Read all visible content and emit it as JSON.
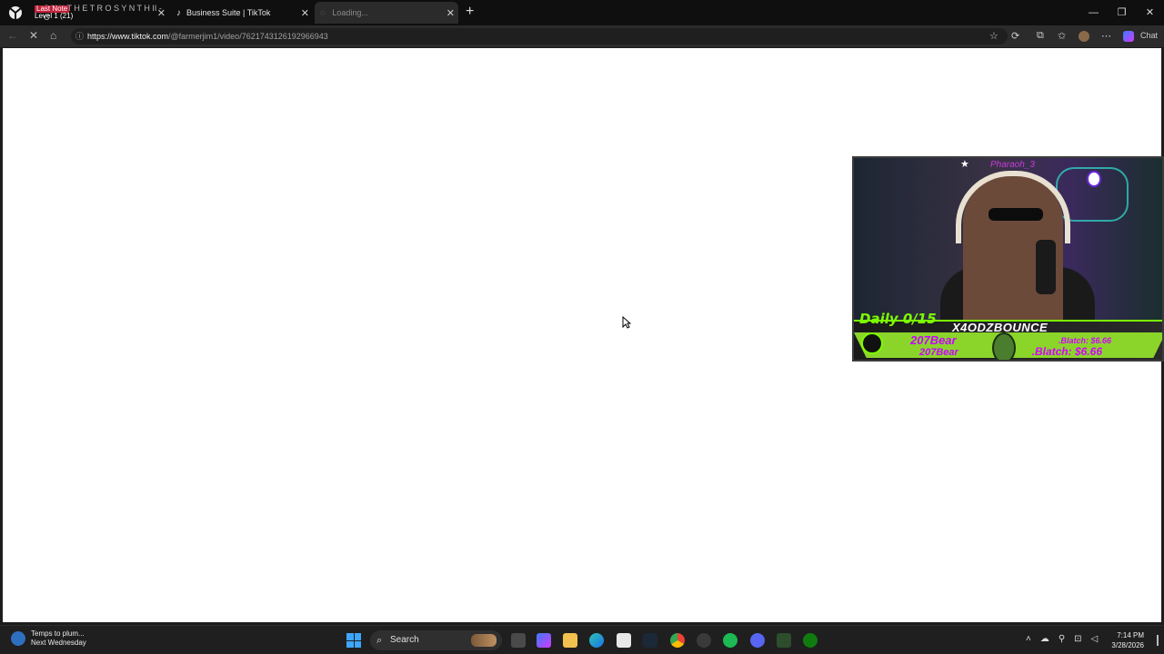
{
  "browser": {
    "tabs": [
      {
        "label": "S Y N T H E T R O S Y N T H II - C",
        "icon": "app-icon"
      },
      {
        "label": "Business Suite | TikTok",
        "icon": "tiktok-icon"
      },
      {
        "label": "Loading...",
        "icon": "loading-icon"
      }
    ],
    "tab_overlay": {
      "line1": "Last Note",
      "line2": "Level 1 (21)"
    },
    "new_tab": "+",
    "url_host": "https://www.tiktok.com",
    "url_path": "/@farmerjim1/video/7621743126192966943",
    "chat_label": "Chat"
  },
  "stream_overlay": {
    "top_name": "Pharaoh_3",
    "daily": "Daily 0/15",
    "channel": "X4ODZBOUNCE",
    "bear_primary": "207Bear",
    "bear_secondary": "207Bear",
    "blatch_primary": ".Blatch: $6.66",
    "blatch_secondary": ".Blatch: $6.66"
  },
  "taskbar": {
    "weather_title": "Temps to plum...",
    "weather_subtitle": "Next Wednesday",
    "search_label": "Search",
    "time": "7:14 PM",
    "date": "3/28/2026"
  }
}
